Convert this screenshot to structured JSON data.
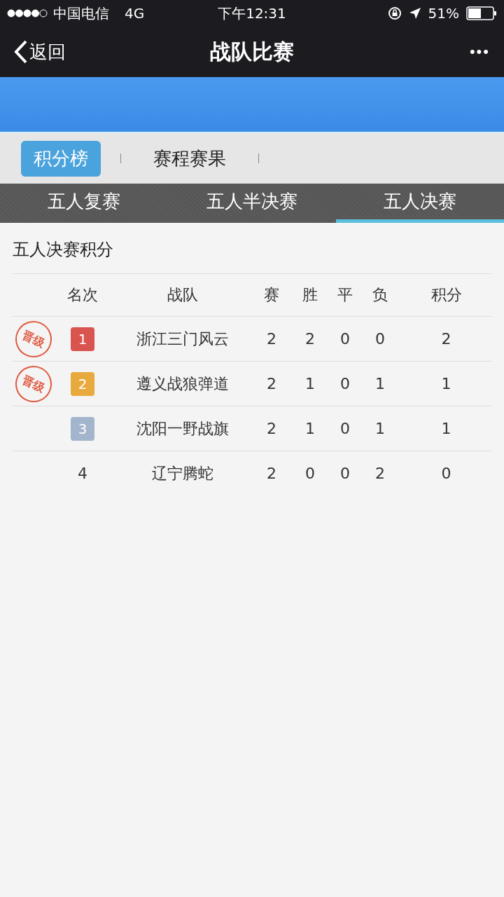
{
  "status_bar": {
    "carrier": "中国电信",
    "network": "4G",
    "time": "下午12:31",
    "battery": "51%"
  },
  "nav": {
    "back": "返回",
    "title": "战队比赛",
    "more": "•••"
  },
  "segments": [
    {
      "label": "积分榜",
      "selected": true
    },
    {
      "label": "赛程赛果",
      "selected": false
    }
  ],
  "tabs": [
    {
      "label": "五人复赛",
      "selected": false
    },
    {
      "label": "五人半决赛",
      "selected": false
    },
    {
      "label": "五人决赛",
      "selected": true
    }
  ],
  "section_title": "五人决赛积分",
  "table": {
    "columns": [
      "名次",
      "战队",
      "赛",
      "胜",
      "平",
      "负",
      "积分"
    ],
    "rows": [
      {
        "stamp": "晋级",
        "rank": "1",
        "color": "#d9534f",
        "team": "浙江三门风云",
        "played": "2",
        "won": "2",
        "drawn": "0",
        "lost": "0",
        "points": "2"
      },
      {
        "stamp": "晋级",
        "rank": "2",
        "color": "#e8a93e",
        "team": "遵义战狼弹道",
        "played": "2",
        "won": "1",
        "drawn": "0",
        "lost": "1",
        "points": "1"
      },
      {
        "rank": "3",
        "color": "#a3b5cc",
        "team": "沈阳一野战旗",
        "played": "2",
        "won": "1",
        "drawn": "0",
        "lost": "1",
        "points": "1"
      },
      {
        "rank": "4",
        "team": "辽宁腾蛇",
        "played": "2",
        "won": "0",
        "drawn": "0",
        "lost": "2",
        "points": "0"
      }
    ]
  }
}
